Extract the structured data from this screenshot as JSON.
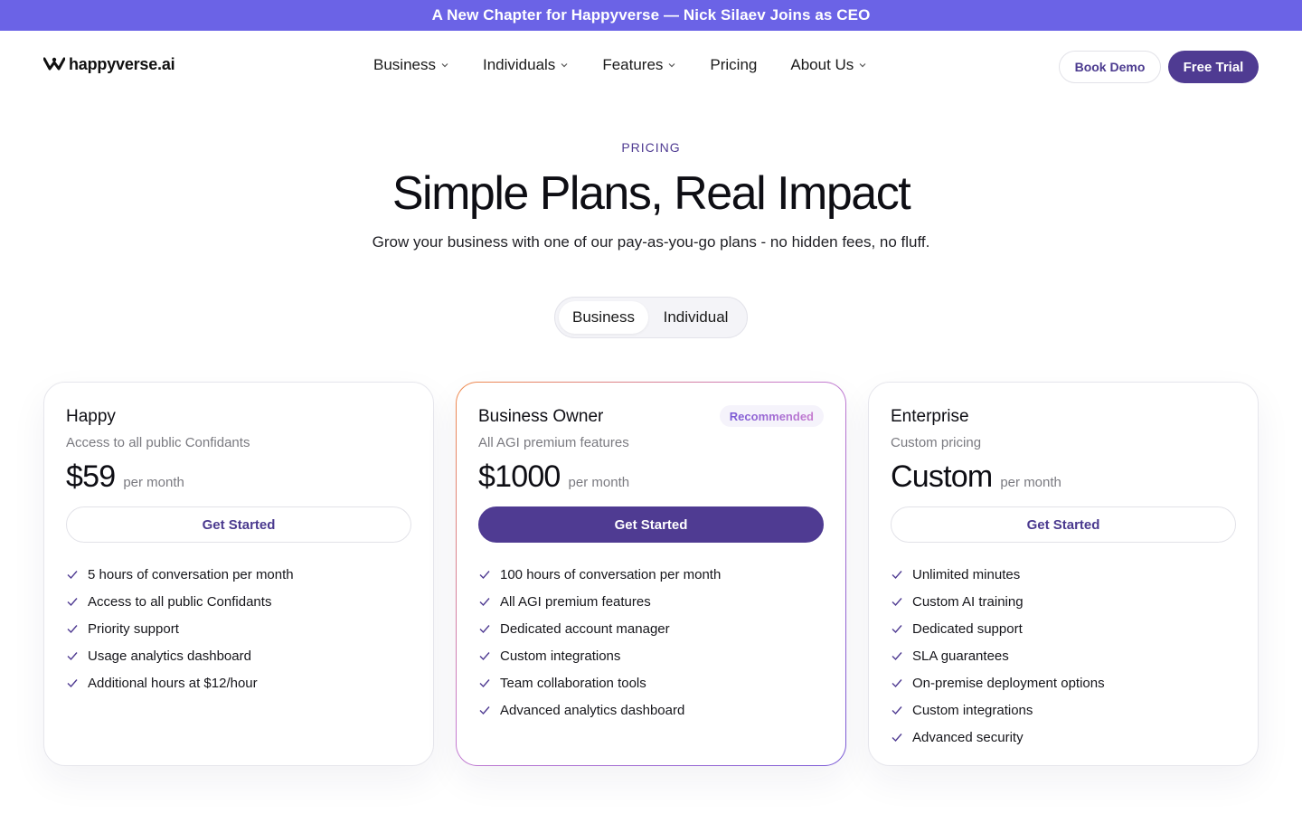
{
  "announcement": "A New Chapter for Happyverse — Nick Silaev Joins as CEO",
  "logo": {
    "text": "happyverse.ai",
    "icon": "happyverse-logo-icon"
  },
  "nav": {
    "items": [
      {
        "label": "Business",
        "dropdown": true
      },
      {
        "label": "Individuals",
        "dropdown": true
      },
      {
        "label": "Features",
        "dropdown": true
      },
      {
        "label": "Pricing",
        "dropdown": false
      },
      {
        "label": "About Us",
        "dropdown": true
      }
    ],
    "book_demo": "Book Demo",
    "free_trial": "Free Trial"
  },
  "hero": {
    "eyebrow": "PRICING",
    "title": "Simple Plans, Real Impact",
    "subtitle": "Grow your business with one of our pay-as-you-go plans - no hidden fees, no fluff."
  },
  "toggle": {
    "options": [
      "Business",
      "Individual"
    ],
    "selected": "Business"
  },
  "plans": [
    {
      "name": "Happy",
      "description": "Access to all public Confidants",
      "price": "$59",
      "period": "per month",
      "cta": "Get Started",
      "badge": "",
      "features": [
        "5 hours of conversation per month",
        "Access to all public Confidants",
        "Priority support",
        "Usage analytics dashboard",
        "Additional hours at $12/hour"
      ]
    },
    {
      "name": "Business Owner",
      "description": "All AGI premium features",
      "price": "$1000",
      "period": "per month",
      "cta": "Get Started",
      "badge": "Recommended",
      "features": [
        "100 hours of conversation per month",
        "All AGI premium features",
        "Dedicated account manager",
        "Custom integrations",
        "Team collaboration tools",
        "Advanced analytics dashboard"
      ]
    },
    {
      "name": "Enterprise",
      "description": "Custom pricing",
      "price": "Custom",
      "period": "per month",
      "cta": "Get Started",
      "badge": "",
      "features": [
        "Unlimited minutes",
        "Custom AI training",
        "Dedicated support",
        "SLA guarantees",
        "On-premise deployment options",
        "Custom integrations",
        "Advanced security"
      ]
    }
  ],
  "colors": {
    "announcement_bg": "#6b63e6",
    "brand_purple": "#4f3b92",
    "muted_text": "#7a7a80",
    "featured_gradient_start": "#f08a4b",
    "featured_gradient_end": "#7a5ad6"
  },
  "icons": {
    "dropdown": "chevron-down-icon",
    "feature": "check-icon"
  }
}
